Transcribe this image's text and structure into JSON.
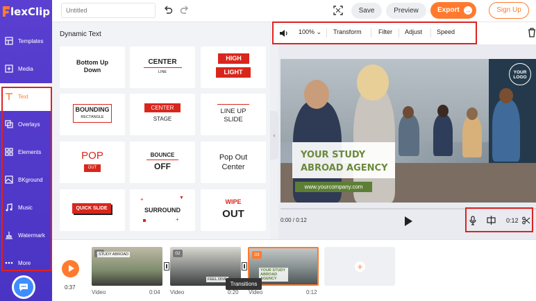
{
  "app": {
    "logo_text": "lexClip"
  },
  "topbar": {
    "title_placeholder": "Untitled",
    "save": "Save",
    "preview": "Preview",
    "export": "Export",
    "signup": "Sign Up"
  },
  "sidebar": {
    "items": [
      {
        "label": "Templates",
        "icon": "templates-icon"
      },
      {
        "label": "Media",
        "icon": "media-icon"
      },
      {
        "label": "Text",
        "icon": "text-icon"
      },
      {
        "label": "Overlays",
        "icon": "overlays-icon"
      },
      {
        "label": "Elements",
        "icon": "elements-icon"
      },
      {
        "label": "BKground",
        "icon": "background-icon"
      },
      {
        "label": "Music",
        "icon": "music-icon"
      },
      {
        "label": "Watermark",
        "icon": "watermark-icon"
      },
      {
        "label": "More",
        "icon": "more-icon"
      }
    ],
    "active": "Text"
  },
  "panel": {
    "title": "Dynamic Text",
    "cards": [
      {
        "lines": [
          "Bottom Up",
          "Down"
        ]
      },
      {
        "lines": [
          "CENTER",
          "LINE"
        ]
      },
      {
        "lines": [
          "HIGH",
          "LIGHT"
        ]
      },
      {
        "lines": [
          "BOUNDING",
          "RECTANGLE"
        ]
      },
      {
        "lines": [
          "CENTER",
          "STAGE"
        ]
      },
      {
        "lines": [
          "LINE UP",
          "SLIDE"
        ]
      },
      {
        "lines": [
          "POP",
          "OUT"
        ]
      },
      {
        "lines": [
          "BOUNCE",
          "OFF"
        ]
      },
      {
        "lines": [
          "Pop Out",
          "Center"
        ]
      },
      {
        "lines": [
          "QUICK SLIDE"
        ]
      },
      {
        "lines": [
          "SURROUND"
        ]
      },
      {
        "lines": [
          "WIPE",
          "OUT"
        ]
      }
    ]
  },
  "toolbar": {
    "volume": "100%",
    "transform": "Transform",
    "filter": "Filter",
    "adjust": "Adjust",
    "speed": "Speed"
  },
  "canvas": {
    "logo": "YOUR LOGO",
    "headline_line1": "YOUR STUDY",
    "headline_line2": "ABROAD AGENCY",
    "url": "www.yourcompany.com"
  },
  "player": {
    "current": "0:00 / 0:12",
    "end": "0:12"
  },
  "timeline": {
    "total": "0:37",
    "clips": [
      {
        "badge": "01",
        "caption": "STUDY ABROAD",
        "type": "Video",
        "duration": "0:04"
      },
      {
        "badge": "02",
        "caption": "FEEL DIVE",
        "type": "Video",
        "duration": "0:20"
      },
      {
        "badge": "03",
        "caption": "YOUR STUDY ABROAD AGENCY",
        "type": "Video",
        "duration": "0:12"
      }
    ],
    "tooltip": "Transitions"
  },
  "colors": {
    "brand": "#5a3fd0",
    "accent": "#ff7a2e",
    "highlight": "#dd2222"
  }
}
